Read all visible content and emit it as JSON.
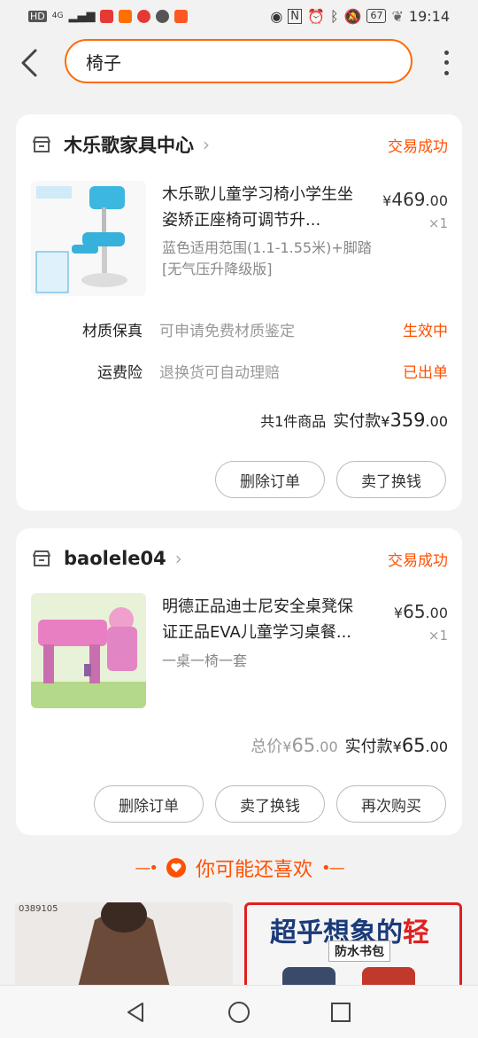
{
  "status_bar": {
    "left_labels": [
      "HD",
      "4G"
    ],
    "battery": "67",
    "time": "19:14"
  },
  "search": {
    "value": "椅子"
  },
  "orders": [
    {
      "shop": "木乐歌家具中心",
      "status": "交易成功",
      "product": {
        "title": "木乐歌儿童学习椅小学生坐姿矫正座椅可调节升...",
        "sku": "蓝色适用范围(1.1-1.55米)+脚踏[无气压升降级版]",
        "price_currency": "¥",
        "price_int": "469",
        "price_dec": ".00",
        "qty": "×1"
      },
      "services": [
        {
          "label": "材质保真",
          "desc": "可申请免费材质鉴定",
          "status": "生效中"
        },
        {
          "label": "运费险",
          "desc": "退换货可自动理赔",
          "status": "已出单"
        }
      ],
      "summary": {
        "count": "共1件商品",
        "paid_label": "实付款",
        "currency": "¥",
        "paid_int": "359",
        "paid_dec": ".00"
      },
      "buttons": [
        "删除订单",
        "卖了换钱"
      ]
    },
    {
      "shop": "baolele04",
      "status": "交易成功",
      "product": {
        "title": "明德正品迪士尼安全桌凳保证正品EVA儿童学习桌餐...",
        "sku": "一桌一椅一套",
        "price_currency": "¥",
        "price_int": "65",
        "price_dec": ".00",
        "qty": "×1"
      },
      "summary": {
        "total_label": "总价",
        "total_currency": "¥",
        "total_int": "65",
        "total_dec": ".00",
        "paid_label": "实付款",
        "currency": "¥",
        "paid_int": "65",
        "paid_dec": ".00"
      },
      "buttons": [
        "删除订单",
        "卖了换钱",
        "再次购买"
      ]
    }
  ],
  "recommend": {
    "header": "你可能还喜欢",
    "items": [
      {
        "code": "0389105"
      },
      {
        "title_main": "超乎想象的",
        "title_accent": "轻",
        "badge": "防水书包"
      }
    ]
  },
  "colors": {
    "accent": "#ff5000",
    "search_border": "#ff6a00"
  }
}
